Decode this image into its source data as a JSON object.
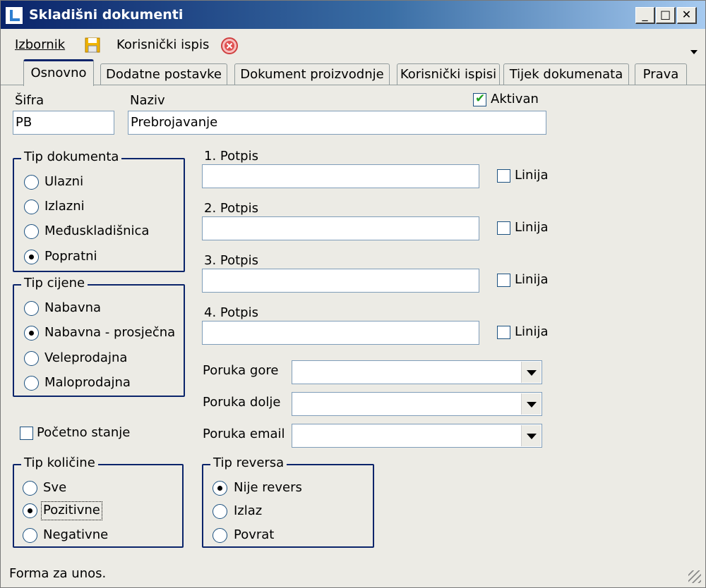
{
  "window": {
    "title": "Skladišni dokumenti",
    "buttons": {
      "minimize": "_",
      "maximize": "□",
      "close": "✕"
    }
  },
  "menubar": {
    "izbornik": "Izbornik",
    "korisnicki_ispis": "Korisnički ispis",
    "save_icon": "save-icon",
    "cancel_icon": "cancel-icon"
  },
  "tabs": [
    {
      "label": "Osnovno",
      "active": true
    },
    {
      "label": "Dodatne postavke",
      "active": false
    },
    {
      "label": "Dokument proizvodnje",
      "active": false
    },
    {
      "label": "Korisnički ispisi",
      "active": false
    },
    {
      "label": "Tijek dokumenata",
      "active": false
    },
    {
      "label": "Prava",
      "active": false
    }
  ],
  "form": {
    "sifra_label": "Šifra",
    "sifra_value": "PB",
    "naziv_label": "Naziv",
    "naziv_value": "Prebrojavanje",
    "aktivan_label": "Aktivan",
    "aktivan_checked": true
  },
  "tip_dokumenta": {
    "title": "Tip dokumenta",
    "options": [
      "Ulazni",
      "Izlazni",
      "Međuskladišnica",
      "Popratni"
    ],
    "selected": "Popratni"
  },
  "tip_cijene": {
    "title": "Tip cijene",
    "options": [
      "Nabavna",
      "Nabavna - prosječna",
      "Veleprodajna",
      "Maloprodajna"
    ],
    "selected": "Nabavna - prosječna"
  },
  "pocetno_stanje": {
    "label": "Početno stanje",
    "checked": false
  },
  "tip_kolicine": {
    "title": "Tip količine",
    "options": [
      "Sve",
      "Pozitivne",
      "Negativne"
    ],
    "selected": "Pozitivne"
  },
  "potpisi": [
    {
      "label": "1. Potpis",
      "value": "",
      "linija": "Linija"
    },
    {
      "label": "2. Potpis",
      "value": "",
      "linija": "Linija"
    },
    {
      "label": "3. Potpis",
      "value": "",
      "linija": "Linija"
    },
    {
      "label": "4. Potpis",
      "value": "",
      "linija": "Linija"
    }
  ],
  "poruke": [
    {
      "label": "Poruka gore",
      "value": ""
    },
    {
      "label": "Poruka dolje",
      "value": ""
    },
    {
      "label": "Poruka email",
      "value": ""
    }
  ],
  "tip_reversa": {
    "title": "Tip reversa",
    "options": [
      "Nije revers",
      "Izlaz",
      "Povrat"
    ],
    "selected": "Nije revers"
  },
  "status": {
    "text": "Forma za unos."
  },
  "colors": {
    "title_start": "#0a246a",
    "title_end": "#a6caf0",
    "window_bg": "#ecebe5",
    "group_border": "#0a246a"
  }
}
